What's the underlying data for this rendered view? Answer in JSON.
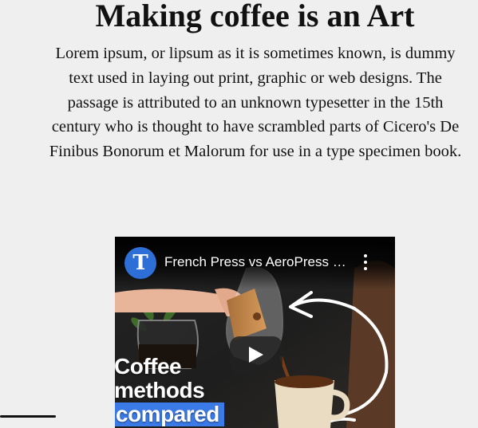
{
  "page": {
    "title": "Making coffee is an Art",
    "intro": "Lorem ipsum, or lipsum as it is sometimes known, is dummy text used in laying out print, graphic or web designs. The passage is attributed to an unknown typesetter in the 15th century who is thought to have scrambled parts of Cicero's De Finibus Bonorum et Malorum for use in a type specimen book."
  },
  "video": {
    "title": "French Press vs AeroPress vs Chemex: Which Is Best?",
    "channel_icon": "nyt-logo",
    "channel_letter": "T",
    "overlay_lines": [
      "Coffee",
      "methods",
      "compared"
    ],
    "play_icon": "play-icon",
    "menu_icon": "more-vertical-icon"
  },
  "colors": {
    "background": "#efefef",
    "avatar": "#2d6fd6",
    "overlay_highlight": "#3b7be8"
  }
}
